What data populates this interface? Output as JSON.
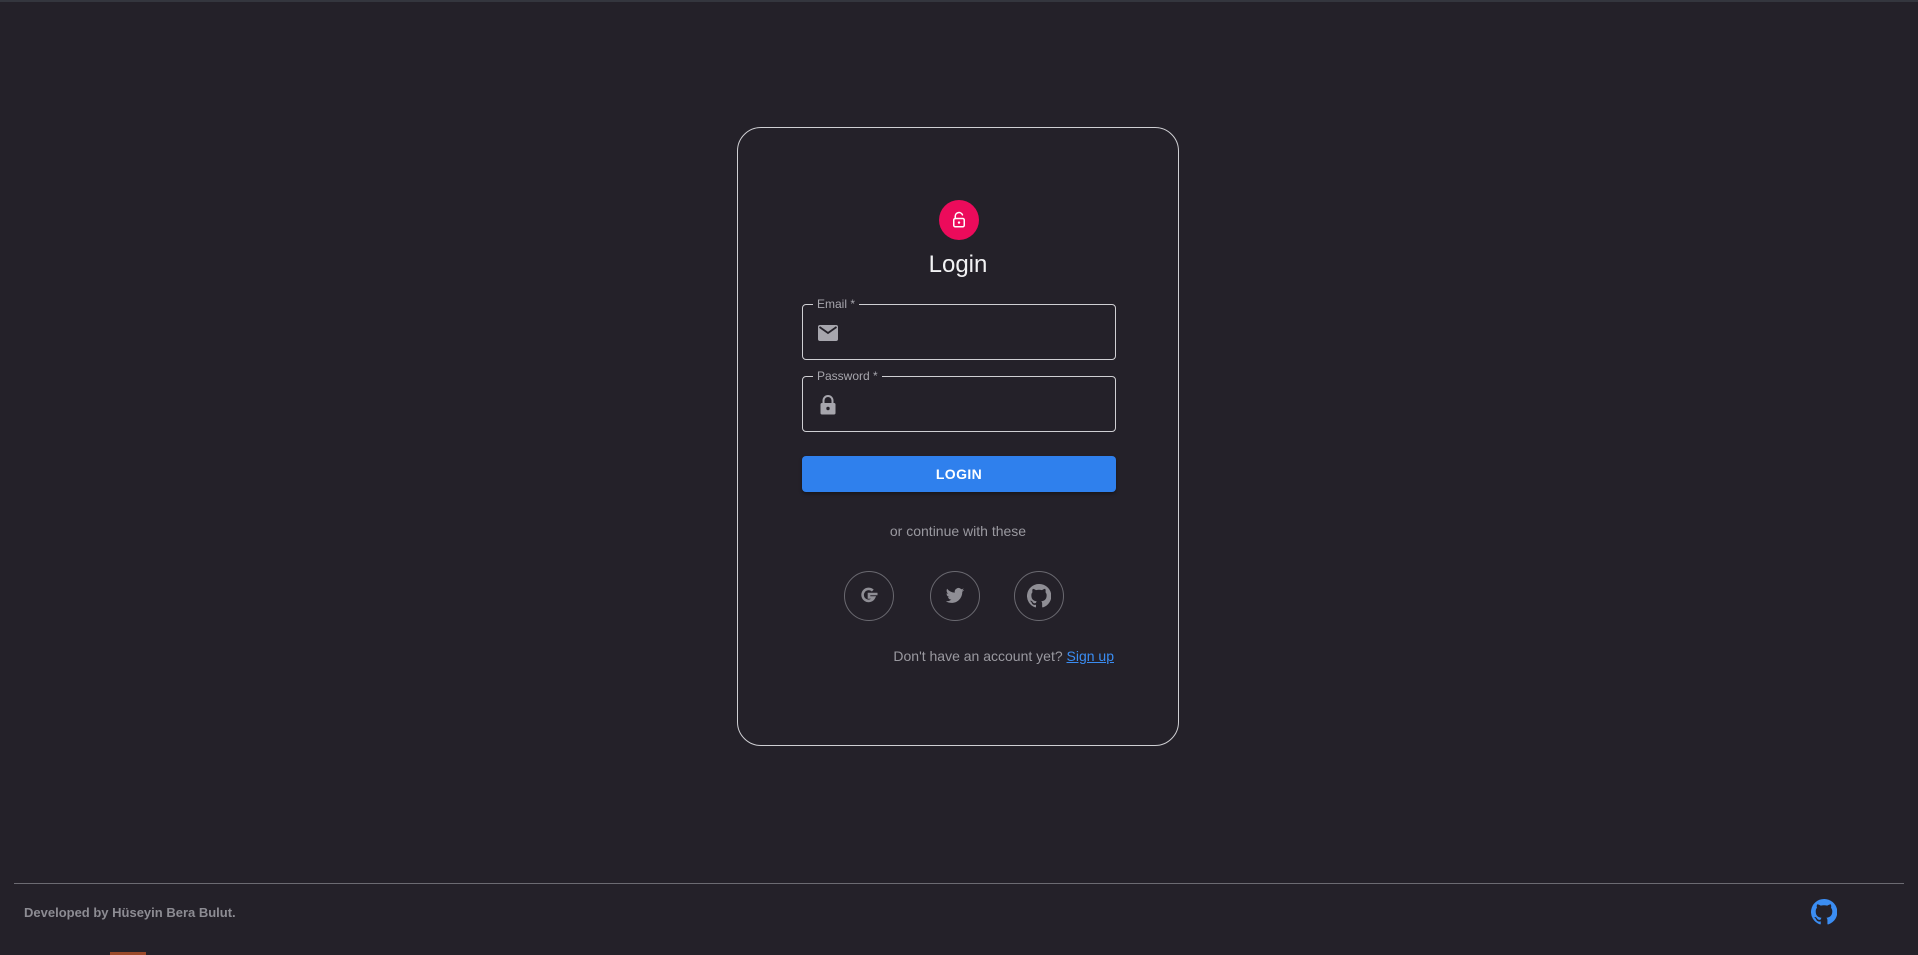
{
  "login_card": {
    "title": "Login",
    "email": {
      "label": "Email *",
      "value": "",
      "placeholder": ""
    },
    "password": {
      "label": "Password *",
      "value": "",
      "placeholder": ""
    },
    "login_button": "LOGIN",
    "divider_text": "or continue with these",
    "social_buttons": [
      {
        "name": "Google",
        "icon": "google-icon"
      },
      {
        "name": "Twitter",
        "icon": "twitter-icon"
      },
      {
        "name": "GitHub",
        "icon": "github-icon"
      }
    ],
    "signup_prompt": "Don't have an account yet?",
    "signup_link": "Sign up"
  },
  "footer": {
    "credit": "Developed by Hüseyin Bera Bulut.",
    "github_icon": "github-icon"
  },
  "colors": {
    "background": "#242129",
    "avatar": "#ec0b5b",
    "primary_button": "#2f80ed",
    "link": "#3b8df2",
    "footer_icon": "#3b8df2"
  }
}
